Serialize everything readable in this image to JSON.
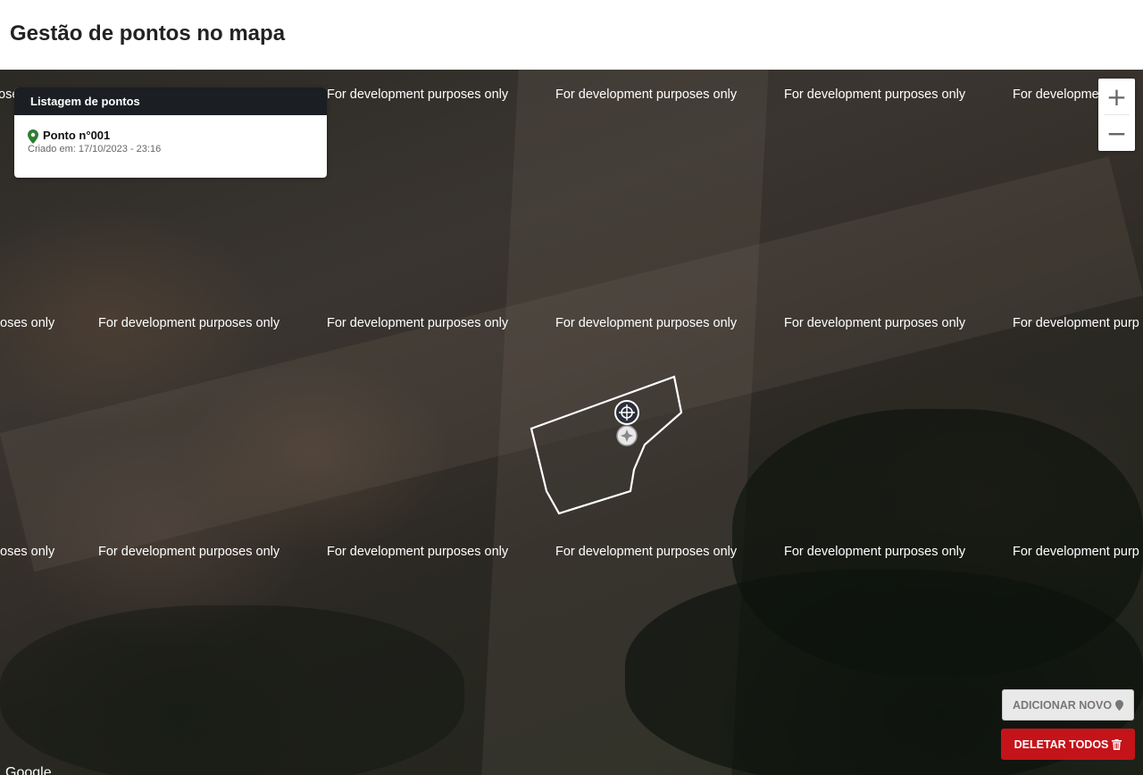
{
  "header": {
    "title": "Gestão de pontos no mapa"
  },
  "map": {
    "watermark_text": "For development purposes only",
    "watermark_left": "For development purposes only",
    "watermark_left_cut": "oses only",
    "watermark_right_cut": "For developme",
    "watermark_right_cut2": "For development purp",
    "watermark_first_cut": "oses only",
    "attribution": "Google"
  },
  "points_list": {
    "title": "Listagem de pontos",
    "items": [
      {
        "label": "Ponto n°001",
        "created": "Criado em: 17/10/2023 - 23:16"
      }
    ]
  },
  "zoom": {
    "in_label": "+",
    "out_label": "−"
  },
  "actions": {
    "add_label": "ADICIONAR NOVO",
    "delete_label": "DELETAR TODOS"
  },
  "colors": {
    "delete_button": "#c4141a",
    "pin": "#2e7d32",
    "panel_header": "#1b1e22"
  }
}
